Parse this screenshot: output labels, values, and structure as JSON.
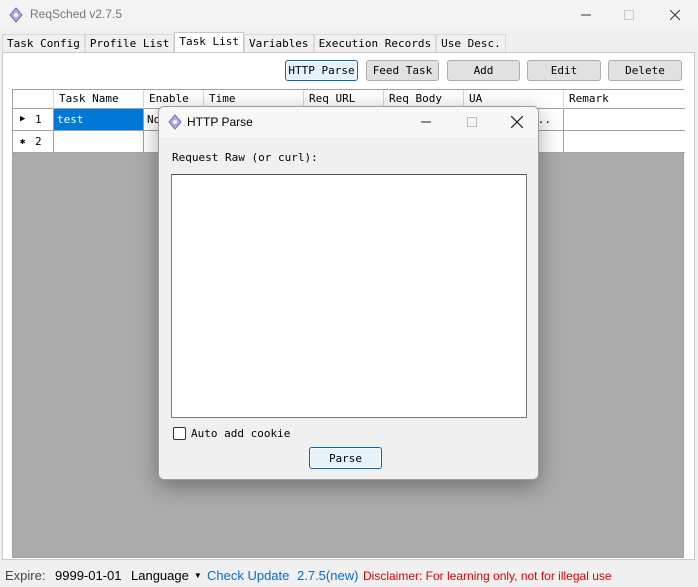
{
  "window": {
    "title": "ReqSched v2.7.5",
    "accent": "#0078d7"
  },
  "tabs": [
    {
      "label": "Task Config"
    },
    {
      "label": "Profile List"
    },
    {
      "label": "Task List"
    },
    {
      "label": "Variables"
    },
    {
      "label": "Execution Records"
    },
    {
      "label": "Use Desc."
    }
  ],
  "toolbar": {
    "http_parse": "HTTP Parse",
    "feed_task": "Feed Task",
    "add": "Add",
    "edit": "Edit",
    "delete": "Delete"
  },
  "grid": {
    "columns": [
      "Task Name",
      "Enable",
      "Time",
      "Req URL",
      "Req Body",
      "UA",
      "Remark"
    ],
    "rows": [
      {
        "num": "1",
        "marker": "▶",
        "task_name": "test",
        "enable": "No",
        "ua_fragment": "..."
      },
      {
        "num": "2",
        "marker": "✱",
        "task_name": "",
        "enable": ""
      }
    ]
  },
  "dialog": {
    "title": "HTTP Parse",
    "label": "Request Raw (or curl):",
    "textarea_value": "",
    "auto_cookie": "Auto add cookie",
    "auto_cookie_checked": false,
    "parse_button": "Parse"
  },
  "status": {
    "expire_label": "Expire:",
    "expire_value": "9999-01-01",
    "language": "Language",
    "check_update": "Check Update",
    "version": "2.7.5(new)",
    "disclaimer": "Disclaimer: For learning only, not for illegal use"
  }
}
